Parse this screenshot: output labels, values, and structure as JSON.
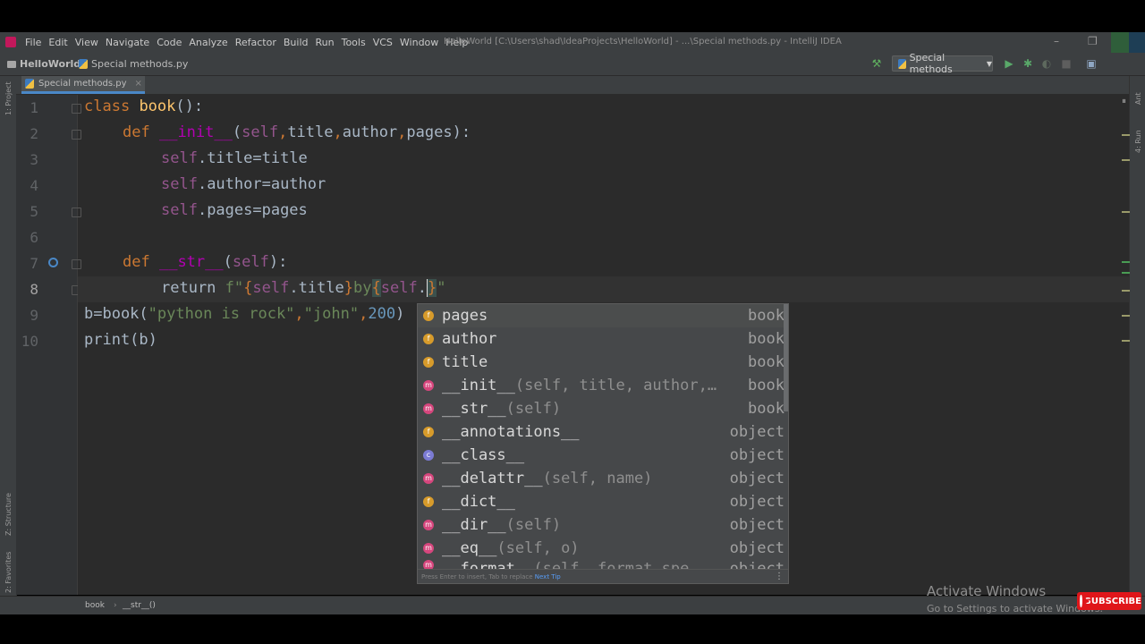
{
  "menu": {
    "items": [
      "File",
      "Edit",
      "View",
      "Navigate",
      "Code",
      "Analyze",
      "Refactor",
      "Build",
      "Run",
      "Tools",
      "VCS",
      "Window",
      "Help"
    ],
    "window_title": "HelloWorld [C:\\Users\\shad\\IdeaProjects\\HelloWorld] - ...\\Special methods.py - IntelliJ IDEA"
  },
  "navbar": {
    "project": "HelloWorld",
    "file": "Special methods.py",
    "run_config": "Special methods"
  },
  "tab": {
    "label": "Special methods.py",
    "close": "×"
  },
  "left_strip": {
    "project": "1: Project",
    "structure": "Z: Structure",
    "favorites": "2: Favorites"
  },
  "right_strip": {
    "ant": "Ant",
    "run": "4: Run"
  },
  "editor": {
    "line_numbers": [
      "1",
      "2",
      "3",
      "4",
      "5",
      "6",
      "7",
      "8",
      "9",
      "10"
    ],
    "lines": {
      "l1": {
        "kw": "class",
        "name": "book",
        "rest": "():"
      },
      "l2": {
        "kw": "def",
        "name": "__init__",
        "open": "(",
        "self": "self",
        "p1": "title",
        "p2": "author",
        "p3": "pages",
        "close": "):"
      },
      "l3": {
        "self": "self",
        "rest": ".title=title"
      },
      "l4": {
        "self": "self",
        "rest": ".author=author"
      },
      "l5": {
        "self": "self",
        "rest": ".pages=pages"
      },
      "l7": {
        "kw": "def",
        "name": "__str__",
        "open": "(",
        "self": "self",
        "close": "):"
      },
      "l8": {
        "kw": "return",
        "prefix": "f\"",
        "lb1": "{",
        "self1": "self",
        "mid1": ".title",
        "rb1": "}",
        "by": "by",
        "lb2": "{",
        "self2": "self",
        "dot": ".",
        "rb2": "}",
        "quote": "\""
      },
      "l9": {
        "pre": "b=book(",
        "s1": "\"python is rock\"",
        "c1": ",",
        "s2": "\"john\"",
        "c2": ",",
        "num": "200",
        "post": ")"
      },
      "l10": {
        "text": "print(b)"
      }
    }
  },
  "completion": {
    "items": [
      {
        "kind": "f",
        "name": "pages",
        "sig": "",
        "type": "book"
      },
      {
        "kind": "f",
        "name": "author",
        "sig": "",
        "type": "book"
      },
      {
        "kind": "f",
        "name": "title",
        "sig": "",
        "type": "book"
      },
      {
        "kind": "m",
        "name": "__init__",
        "sig": "(self, title, author,…",
        "type": "book"
      },
      {
        "kind": "m",
        "name": "__str__",
        "sig": "(self)",
        "type": "book"
      },
      {
        "kind": "f",
        "name": "__annotations__",
        "sig": "",
        "type": "object"
      },
      {
        "kind": "c",
        "name": "__class__",
        "sig": "",
        "type": "object"
      },
      {
        "kind": "m",
        "name": "__delattr__",
        "sig": "(self, name)",
        "type": "object"
      },
      {
        "kind": "f",
        "name": "__dict__",
        "sig": "",
        "type": "object"
      },
      {
        "kind": "m",
        "name": "__dir__",
        "sig": "(self)",
        "type": "object"
      },
      {
        "kind": "m",
        "name": "__eq__",
        "sig": "(self, o)",
        "type": "object"
      },
      {
        "kind": "m",
        "name": "__format__",
        "sig": "(self, format_spe…",
        "type": "object"
      }
    ],
    "footer_text": "Press Enter to insert, Tab to replace",
    "footer_link": "Next Tip"
  },
  "statusbar": {
    "crumb1": "book",
    "crumb2": "__str__()"
  },
  "watermark": {
    "line1": "Activate Windows",
    "line2": "Go to Settings to activate Windows."
  },
  "subscribe": "SUBSCRIBE",
  "colors": {
    "accent": "#4a88c7",
    "keyword": "#cc7832",
    "function": "#ffc66d",
    "self": "#94558d",
    "string": "#6a8759"
  }
}
